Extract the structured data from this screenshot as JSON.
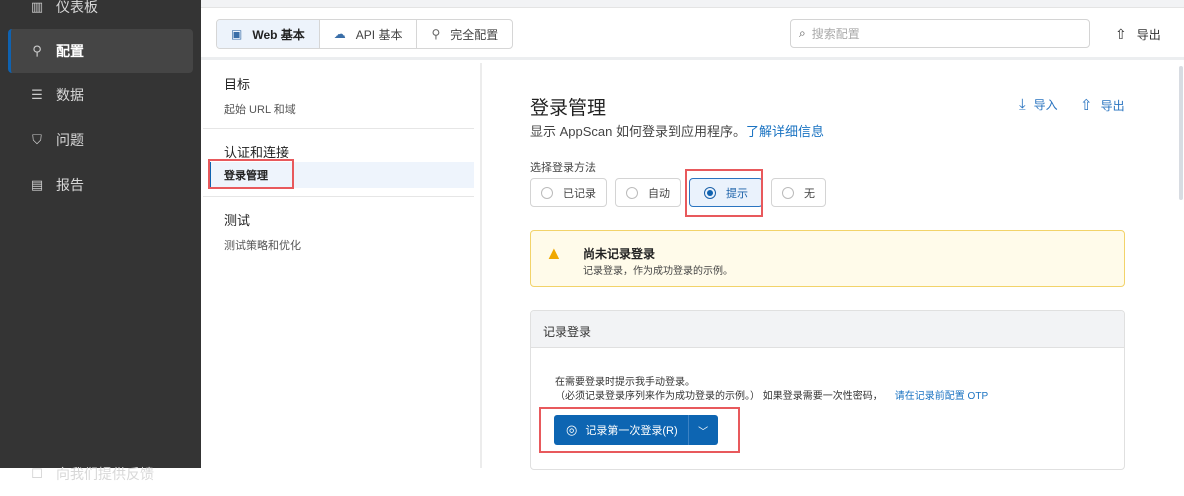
{
  "sidebar": {
    "items": [
      {
        "label": "仪表板",
        "icon": "bar-chart-icon"
      },
      {
        "label": "配置",
        "icon": "wrench-icon"
      },
      {
        "label": "数据",
        "icon": "database-icon"
      },
      {
        "label": "问题",
        "icon": "shield-icon"
      },
      {
        "label": "报告",
        "icon": "report-icon"
      }
    ],
    "feedback": "向我们提供反馈"
  },
  "toolbar": {
    "tabs": [
      "Web 基本",
      "API 基本",
      "完全配置"
    ],
    "search_placeholder": "搜索配置",
    "export": "导出"
  },
  "leftnav": {
    "sections": [
      {
        "heading": "目标",
        "items": [
          "起始 URL 和域"
        ]
      },
      {
        "heading": "认证和连接",
        "items": [
          "登录管理"
        ]
      },
      {
        "heading": "测试",
        "items": [
          "测试策略和优化"
        ]
      }
    ]
  },
  "main": {
    "title": "登录管理",
    "subtitle": "显示 AppScan 如何登录到应用程序。",
    "learn_more": "了解详细信息",
    "import": "导入",
    "export": "导出",
    "method_label": "选择登录方法",
    "methods": [
      "已记录",
      "自动",
      "提示",
      "无"
    ],
    "selected_method": "提示",
    "warning": {
      "title": "尚未记录登录",
      "desc": "记录登录，作为成功登录的示例。"
    },
    "panel": {
      "title": "记录登录",
      "line1": "在需要登录时提示我手动登录。",
      "line2": "（必须记录登录序列来作为成功登录的示例。） 如果登录需要一次性密码，",
      "otp_link": "请在记录前配置 OTP",
      "button": "记录第一次登录(R)"
    }
  }
}
